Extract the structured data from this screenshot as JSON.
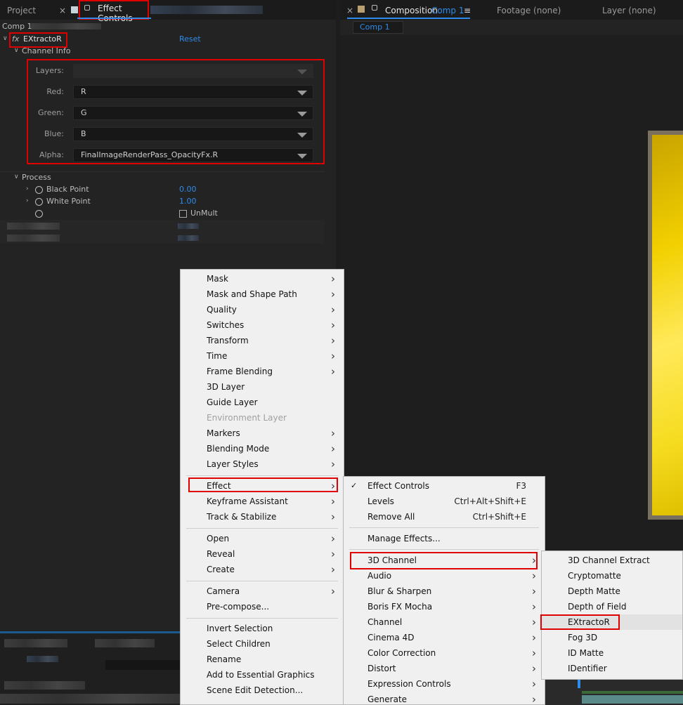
{
  "left_tabs": {
    "project": "Project",
    "effect_controls": "Effect Controls",
    "close": "×"
  },
  "breadcrumb": "Comp 1",
  "effect": {
    "fx": "fx",
    "name": "EXtractoR",
    "reset": "Reset"
  },
  "channel_info": {
    "label": "Channel Info",
    "layers_label": "Layers:",
    "red_label": "Red:",
    "red_value": "R",
    "green_label": "Green:",
    "green_value": "G",
    "blue_label": "Blue:",
    "blue_value": "B",
    "alpha_label": "Alpha:",
    "alpha_value": "FinalImageRenderPass_OpacityFx.R"
  },
  "process": {
    "label": "Process",
    "black_point_label": "Black Point",
    "black_point_value": "0.00",
    "white_point_label": "White Point",
    "white_point_value": "1.00",
    "unmult_label": "UnMult"
  },
  "right_tabs": {
    "close": "×",
    "composition_label": "Composition",
    "composition_name": "Comp 1",
    "menu_glyph": "≡",
    "footage": "Footage (none)",
    "layer": "Layer (none)",
    "comp_subtab": "Comp 1"
  },
  "context_menu": [
    {
      "label": "Mask",
      "sub": true
    },
    {
      "label": "Mask and Shape Path",
      "sub": true
    },
    {
      "label": "Quality",
      "sub": true
    },
    {
      "label": "Switches",
      "sub": true
    },
    {
      "label": "Transform",
      "sub": true
    },
    {
      "label": "Time",
      "sub": true
    },
    {
      "label": "Frame Blending",
      "sub": true
    },
    {
      "label": "3D Layer",
      "sub": false
    },
    {
      "label": "Guide Layer",
      "sub": false
    },
    {
      "label": "Environment Layer",
      "sub": false,
      "disabled": true
    },
    {
      "label": "Markers",
      "sub": true
    },
    {
      "label": "Blending Mode",
      "sub": true
    },
    {
      "label": "Layer Styles",
      "sub": true
    },
    {
      "label": "Effect",
      "sub": true
    },
    {
      "label": "Keyframe Assistant",
      "sub": true
    },
    {
      "label": "Track & Stabilize",
      "sub": true
    },
    {
      "label": "Open",
      "sub": true
    },
    {
      "label": "Reveal",
      "sub": true
    },
    {
      "label": "Create",
      "sub": true
    },
    {
      "label": "Camera",
      "sub": true
    },
    {
      "label": "Pre-compose...",
      "sub": false
    },
    {
      "label": "Invert Selection",
      "sub": false
    },
    {
      "label": "Select Children",
      "sub": false
    },
    {
      "label": "Rename",
      "sub": false
    },
    {
      "label": "Add to Essential Graphics",
      "sub": false
    },
    {
      "label": "Scene Edit Detection...",
      "sub": false
    }
  ],
  "effect_menu": {
    "check_glyph": "✓",
    "effect_controls": "Effect Controls",
    "effect_controls_sc": "F3",
    "levels": "Levels",
    "levels_sc": "Ctrl+Alt+Shift+E",
    "remove_all": "Remove All",
    "remove_all_sc": "Ctrl+Shift+E",
    "manage": "Manage Effects...",
    "categories": [
      "3D Channel",
      "Audio",
      "Blur & Sharpen",
      "Boris FX Mocha",
      "Channel",
      "Cinema 4D",
      "Color Correction",
      "Distort",
      "Expression Controls",
      "Generate"
    ]
  },
  "channel_menu": [
    "3D Channel Extract",
    "Cryptomatte",
    "Depth Matte",
    "Depth of Field",
    "EXtractoR",
    "Fog 3D",
    "ID Matte",
    "IDentifier"
  ],
  "colors": {
    "highlight": "#e00000",
    "accent": "#2d8ceb",
    "menu_bg": "#f0f0f0",
    "comp_yellow": "#f2d000"
  }
}
